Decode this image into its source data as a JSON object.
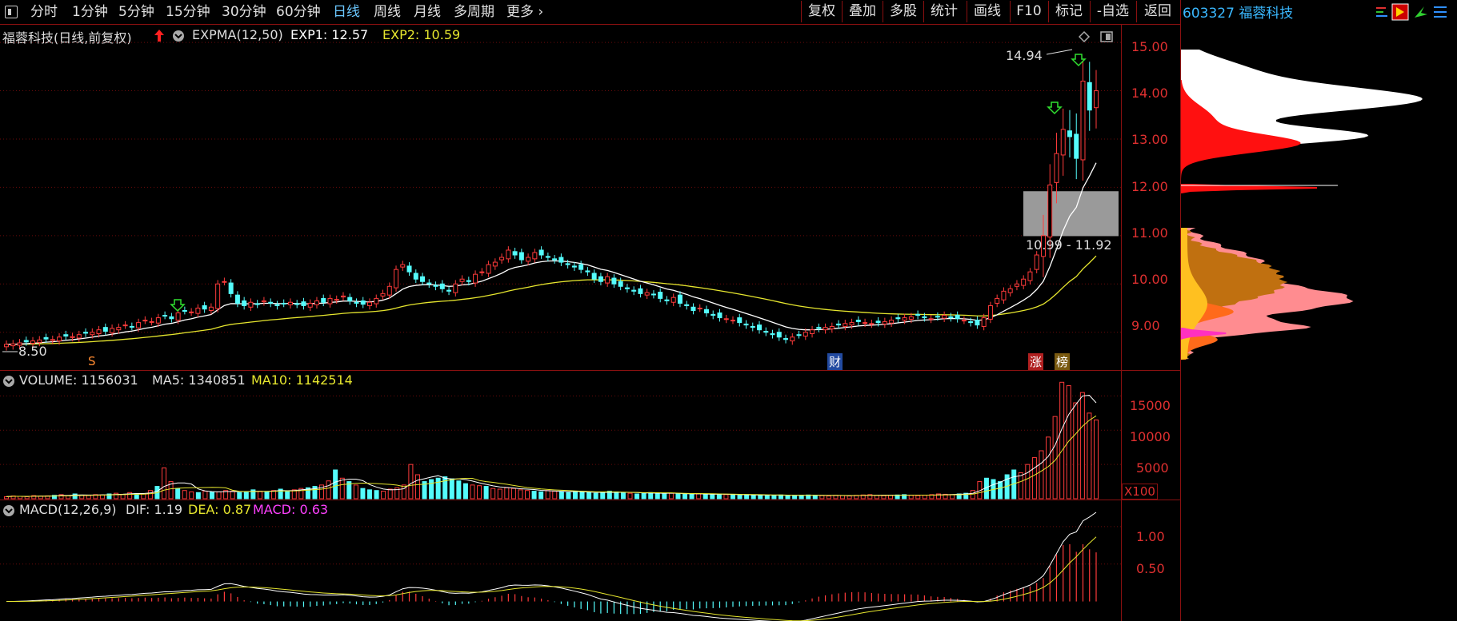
{
  "toolbar": {
    "left_items": [
      "分时",
      "1分钟",
      "5分钟",
      "15分钟",
      "30分钟",
      "60分钟",
      "日线",
      "周线",
      "月线",
      "多周期",
      "更多"
    ],
    "active": "日线",
    "right_items": [
      "复权",
      "叠加",
      "多股",
      "统计",
      "画线",
      "F10",
      "标记",
      "-自选",
      "返回"
    ]
  },
  "stock": {
    "code": "603327",
    "name": "福蓉科技"
  },
  "main_chart": {
    "title": "福蓉科技(日线,前复权)",
    "indicator": "EXPMA(12,50)",
    "exp1_label": "EXP1: 12.57",
    "exp2_label": "EXP2: 10.59",
    "high_label": "14.94",
    "low_label": "8.50",
    "range_label": "10.99 - 11.92",
    "markers": {
      "s": "S",
      "cai": "财",
      "zhang": "涨",
      "bang": "榜"
    }
  },
  "volume_chart": {
    "label": "VOLUME: 1156031",
    "ma5_label": "MA5: 1340851",
    "ma10_label": "MA10: 1142514",
    "unit": "X100"
  },
  "macd_chart": {
    "label": "MACD(12,26,9)",
    "dif_label": "DIF: 1.19",
    "dea_label": "DEA: 0.87",
    "macd_label": "MACD: 0.63"
  },
  "colors": {
    "up": "#ff3b3b",
    "down": "#54fcfc",
    "exp1": "#ffffff",
    "exp2": "#e6e62e",
    "frame": "#8a1010",
    "macd": "#ff40ff"
  },
  "chart_data": [
    {
      "type": "candlestick",
      "y_ticks": [
        "15.00",
        "14.00",
        "13.00",
        "12.00",
        "11.00",
        "10.00",
        "9.00"
      ],
      "ylim": [
        8.3,
        15.3
      ],
      "close": [
        8.75,
        8.76,
        8.78,
        8.8,
        8.82,
        8.84,
        8.86,
        8.85,
        8.9,
        8.92,
        8.91,
        8.95,
        8.98,
        9.0,
        9.05,
        9.02,
        9.08,
        9.1,
        9.15,
        9.12,
        9.2,
        9.25,
        9.22,
        9.3,
        9.35,
        9.28,
        9.4,
        9.45,
        9.42,
        9.5,
        9.48,
        9.52,
        10.0,
        10.05,
        9.8,
        9.6,
        9.55,
        9.62,
        9.58,
        9.65,
        9.6,
        9.55,
        9.6,
        9.62,
        9.58,
        9.55,
        9.6,
        9.65,
        9.62,
        9.7,
        9.68,
        9.75,
        9.65,
        9.6,
        9.58,
        9.62,
        9.7,
        9.8,
        9.95,
        10.3,
        10.4,
        10.25,
        10.1,
        10.05,
        10.0,
        9.95,
        9.9,
        9.85,
        10.0,
        10.1,
        10.05,
        10.2,
        10.25,
        10.4,
        10.45,
        10.55,
        10.7,
        10.6,
        10.5,
        10.55,
        10.65,
        10.6,
        10.55,
        10.5,
        10.45,
        10.4,
        10.35,
        10.3,
        10.25,
        10.1,
        10.05,
        10.15,
        10.0,
        9.95,
        9.9,
        9.85,
        9.8,
        9.82,
        9.78,
        9.7,
        9.65,
        9.72,
        9.6,
        9.55,
        9.45,
        9.5,
        9.4,
        9.35,
        9.3,
        9.28,
        9.25,
        9.2,
        9.15,
        9.1,
        9.05,
        9.0,
        8.95,
        8.9,
        8.85,
        8.9,
        8.95,
        9.0,
        9.05,
        9.08,
        9.1,
        9.12,
        9.15,
        9.18,
        9.2,
        9.22,
        9.2,
        9.18,
        9.2,
        9.22,
        9.25,
        9.28,
        9.3,
        9.32,
        9.35,
        9.3,
        9.28,
        9.32,
        9.35,
        9.3,
        9.28,
        9.25,
        9.2,
        9.15,
        9.3,
        9.55,
        9.7,
        9.85,
        9.9,
        10.0,
        10.1,
        10.25,
        10.6,
        11.0,
        12.05,
        12.7,
        13.2,
        13.05,
        12.6,
        14.2,
        13.6,
        14.0
      ],
      "exp1_last": 12.57,
      "exp2_last": 10.59,
      "gap_range": [
        10.99,
        11.92
      ]
    },
    {
      "type": "bar",
      "name": "volume",
      "y_ticks": [
        "15000",
        "10000",
        "5000"
      ],
      "ylim": [
        0,
        17500
      ],
      "values": [
        300,
        400,
        350,
        300,
        450,
        380,
        420,
        500,
        600,
        450,
        700,
        500,
        480,
        600,
        550,
        700,
        800,
        650,
        900,
        750,
        700,
        1200,
        1800,
        4500,
        2500,
        1500,
        1200,
        1000,
        900,
        1100,
        950,
        1000,
        1200,
        1100,
        900,
        1000,
        1300,
        1100,
        1000,
        1200,
        1400,
        1100,
        1300,
        1500,
        1600,
        1800,
        2000,
        2600,
        4200,
        3000,
        2500,
        2000,
        1500,
        1300,
        1200,
        1100,
        1400,
        1600,
        2000,
        5000,
        3500,
        2500,
        2800,
        3000,
        3200,
        2900,
        2600,
        2200,
        2000,
        1900,
        1800,
        1500,
        1400,
        1600,
        1500,
        1300,
        1200,
        1100,
        1000,
        1200,
        1100,
        1000,
        900,
        1100,
        1000,
        900,
        800,
        900,
        1100,
        1000,
        900,
        800,
        700,
        850,
        900,
        800,
        700,
        800,
        750,
        700,
        650,
        700,
        600,
        650,
        700,
        600,
        550,
        500,
        600,
        550,
        500,
        450,
        500,
        550,
        500,
        450,
        500,
        550,
        500,
        450,
        400,
        500,
        450,
        400,
        500,
        550,
        600,
        500,
        450,
        500,
        550,
        600,
        500,
        450,
        500,
        600,
        700,
        650,
        600,
        700,
        800,
        1200,
        2500,
        3000,
        2800,
        2500,
        3500,
        4200,
        3800,
        5000,
        6000,
        7000,
        9000,
        12000,
        17000,
        16500,
        14000,
        15500,
        12500,
        11500
      ],
      "unit": "X100"
    },
    {
      "type": "bar",
      "name": "macd",
      "y_ticks": [
        "1.00",
        "0.50"
      ],
      "ylim": [
        -0.25,
        1.35
      ],
      "dif_last": 1.19,
      "dea_last": 0.87,
      "macd_last": 0.63
    }
  ]
}
